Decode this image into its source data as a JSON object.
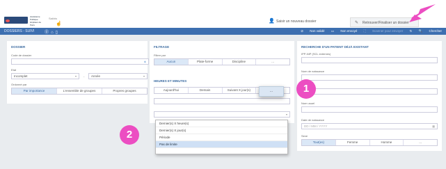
{
  "header": {
    "brand_small": "Assistance Publique Hôpitaux de Paris",
    "brand_name": "Sakhis",
    "new_folder": "Saisir un nouveau dossier",
    "retrieve": "Retrouver/Finaliser un dossier"
  },
  "nav": {
    "title": "DOSSIERS - SUIVI",
    "icons": [
      "⓪",
      "⌂",
      "▯"
    ],
    "not_validated": "Non validé",
    "not_sent": "Non envoyé",
    "scan_send": "Scanner pour envoyer",
    "search": "Chercher"
  },
  "dossier": {
    "title": "DOSSIER",
    "code_label": "Code de dossier",
    "state_label": "Etat",
    "state_value": "Incomplet",
    "year_value": "Année",
    "order_label": "Ordonné par",
    "order_options": [
      "Par importance",
      "L'ensemble de groupes",
      "Propres groupes"
    ],
    "order_active": 0
  },
  "filtrage": {
    "title": "FILTRAGE",
    "filter_label": "Filtrer par",
    "filter_options": [
      "Aucun",
      "Plate-forme",
      "Discipline",
      "..."
    ],
    "filter_active": 0,
    "hours_title": "HEURES ET MINUTES",
    "time_options": [
      "Aujourd'hui",
      "Demain",
      "Suivant X jour(s)",
      "..."
    ],
    "dropdown": [
      "Dernier(s) X heure(s)",
      "Dernier(s) X jour(s)",
      "Période",
      "Pas de limite"
    ],
    "dropdown_selected": 3
  },
  "patient": {
    "title": "RECHERCHE D'UN PATIENT DÉJÀ EXISTANT",
    "ipp_label": "IPP-NIP (SCL externes)",
    "birth_name_label": "Nom de naissance",
    "used_name_label": "Nom usuel",
    "dob_label": "Date de naissance",
    "dob_placeholder": "DD / MM / YYYY",
    "sex_label": "Sexe",
    "sex_options": [
      "Tout(es)",
      "Femme",
      "Homme",
      "..."
    ],
    "sex_active": 0
  },
  "annotations": {
    "one": "1",
    "two": "2"
  },
  "colors": {
    "nav": "#3d6fb0",
    "accent": "#ec4ec2",
    "active_seg": "#dbe8f7"
  }
}
